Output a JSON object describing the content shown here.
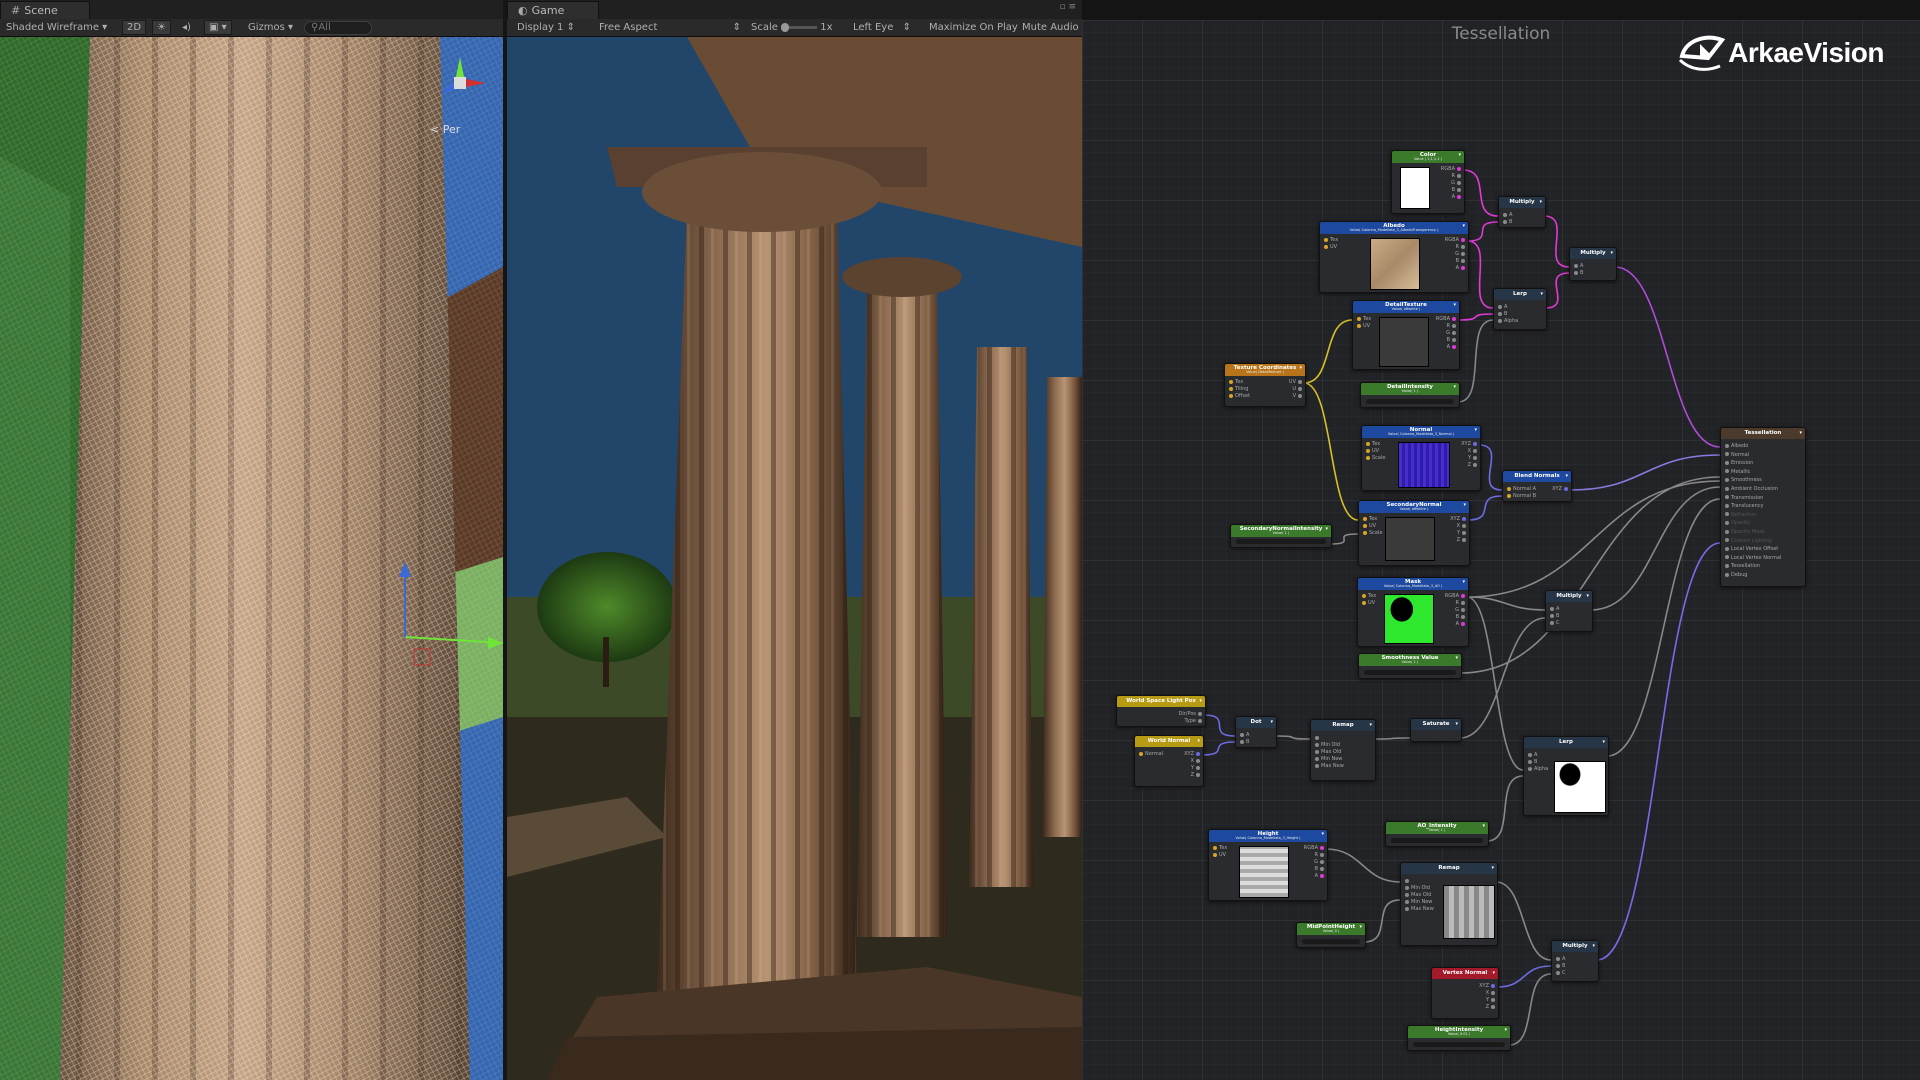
{
  "scene": {
    "tab_label": "Scene",
    "shading_mode": "Shaded Wireframe",
    "mode_2d": "2D",
    "gizmos_label": "Gizmos",
    "search_placeholder": "All",
    "orientation_label": "< Per"
  },
  "game": {
    "tab_label": "Game",
    "display": "Display 1",
    "aspect": "Free Aspect",
    "scale_label": "Scale",
    "scale_value": "1x",
    "eye": "Left Eye",
    "maximize": "Maximize On Play",
    "mute": "Mute Audio"
  },
  "graph": {
    "title": "Tessellation",
    "logo_text": "ArkaeVision",
    "nodes": {
      "color": {
        "title": "Color",
        "subtitle": "Value ( 1,1,1,1 )",
        "ports": [
          "RGBA",
          "R",
          "G",
          "B",
          "A"
        ]
      },
      "multiply1": {
        "title": "Multiply",
        "ports": [
          "A",
          "B"
        ]
      },
      "albedo": {
        "title": "Albedo",
        "subtitle": "Value( Colonna_Modellata_3_AlbedoTransparency )",
        "in": [
          "Tex",
          "UV"
        ],
        "ports": [
          "RGBA",
          "R",
          "G",
          "B",
          "A"
        ]
      },
      "multiply2": {
        "title": "Multiply",
        "ports": [
          "A",
          "B"
        ]
      },
      "lerp1": {
        "title": "Lerp",
        "ports": [
          "A",
          "B",
          "Alpha"
        ]
      },
      "detail_texture": {
        "title": "DetailTexture",
        "subtitle": "Value( offwhite )",
        "in": [
          "Tex",
          "UV"
        ],
        "ports": [
          "RGBA",
          "R",
          "G",
          "B",
          "A"
        ]
      },
      "texcoord": {
        "title": "Texture Coordinates",
        "subtitle": "Value( DetailTexture )",
        "in": [
          "Tex",
          "Tiling",
          "Offset"
        ],
        "ports": [
          "UV",
          "U",
          "V"
        ]
      },
      "detail_intensity": {
        "title": "DetailIntensity",
        "subtitle": "Value( 1 )"
      },
      "normal": {
        "title": "Normal",
        "subtitle": "Value( Colonna_Modellata_3_Normal )",
        "in": [
          "Tex",
          "UV",
          "Scale"
        ],
        "ports": [
          "XYZ",
          "X",
          "Y",
          "Z"
        ]
      },
      "blend_normals": {
        "title": "Blend Normals",
        "in": [
          "Normal A",
          "Normal B"
        ],
        "ports": [
          "XYZ"
        ]
      },
      "secondary_normal": {
        "title": "SecondaryNormal",
        "subtitle": "Value( offwhite )",
        "in": [
          "Tex",
          "UV",
          "Scale"
        ],
        "ports": [
          "XYZ",
          "X",
          "Y",
          "Z"
        ]
      },
      "secondary_normal_intensity": {
        "title": "SecondaryNormalIntensity",
        "subtitle": "Value( 1 )"
      },
      "mask": {
        "title": "Mask",
        "subtitle": "Value( Colonna_Modellata_3_AO )",
        "in": [
          "Tex",
          "UV"
        ],
        "ports": [
          "RGBA",
          "R",
          "G",
          "B",
          "A"
        ]
      },
      "multiply3": {
        "title": "Multiply",
        "ports": [
          "A",
          "B",
          "C"
        ]
      },
      "smoothness": {
        "title": "Smoothness Value",
        "subtitle": "Value( 1 )"
      },
      "tessellation": {
        "title": "Tessellation",
        "ports": [
          "Albedo",
          "Normal",
          "Emission",
          "Metallic",
          "Smoothness",
          "Ambient Occlusion",
          "Transmission",
          "Translucency",
          "Refraction",
          "Opacity",
          "Opacity Mask",
          "Custom Lighting",
          "Local Vertex Offset",
          "Local Vertex Normal",
          "Tessellation",
          "Debug"
        ]
      },
      "wslight": {
        "title": "World Space Light Pos",
        "ports": [
          "Dir/Pos",
          "Type"
        ]
      },
      "worldnormal": {
        "title": "World Normal",
        "in": [
          "Normal"
        ],
        "ports": [
          "XYZ",
          "X",
          "Y",
          "Z"
        ]
      },
      "dot": {
        "title": "Dot",
        "ports": [
          "A",
          "B"
        ]
      },
      "remap1": {
        "title": "Remap",
        "ports": [
          "",
          "Min Old",
          "Max Old",
          "Min New",
          "Max New"
        ]
      },
      "saturate": {
        "title": "Saturate"
      },
      "lerp2": {
        "title": "Lerp",
        "ports": [
          "A",
          "B",
          "Alpha"
        ]
      },
      "ao_intensity": {
        "title": "AO_Intensity",
        "subtitle": "Value( 1 )"
      },
      "height": {
        "title": "Height",
        "subtitle": "Value( Colonna_Modellata_3_Height )",
        "in": [
          "Tex",
          "UV"
        ],
        "ports": [
          "RGBA",
          "R",
          "G",
          "B",
          "A"
        ]
      },
      "remap2": {
        "title": "Remap",
        "ports": [
          "",
          "Min Old",
          "Max Old",
          "Min New",
          "Max New"
        ]
      },
      "midpoint": {
        "title": "MidPointHeight",
        "subtitle": "Value( 0 )"
      },
      "multiply4": {
        "title": "Multiply",
        "ports": [
          "A",
          "B",
          "C"
        ]
      },
      "vertex_normal": {
        "title": "Vertex Normal",
        "ports": [
          "XYZ",
          "X",
          "Y",
          "Z"
        ]
      },
      "height_intensity": {
        "title": "HeightIntensity",
        "subtitle": "Value( 0.01 )"
      }
    }
  }
}
